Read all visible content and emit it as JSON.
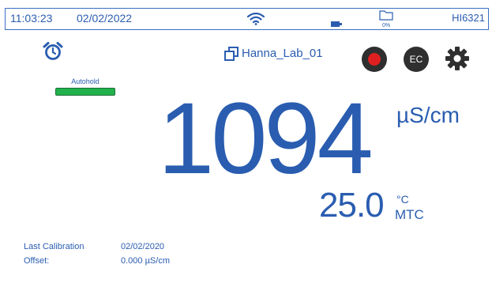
{
  "status_bar": {
    "time": "11:03:23",
    "date": "02/02/2022",
    "storage_percent": "0%",
    "model": "HI6321",
    "icons": [
      "wifi-icon",
      "battery-icon",
      "folder-icon"
    ]
  },
  "header": {
    "lab_name": "Hanna_Lab_01",
    "ec_button_label": "EC"
  },
  "autohold": {
    "label": "Autohold",
    "color": "#22b24c"
  },
  "measurement": {
    "value": "1094",
    "unit": "µS/cm"
  },
  "temperature": {
    "value": "25.0",
    "unit": "°C",
    "mode": "MTC"
  },
  "info": {
    "last_calibration_label": "Last Calibration",
    "last_calibration_value": "02/02/2020",
    "offset_label": "Offset:",
    "offset_value": "0.000 µS/cm"
  },
  "colors": {
    "accent": "#2a5db0",
    "record": "#e02020",
    "button_bg": "#2f2f2f"
  }
}
